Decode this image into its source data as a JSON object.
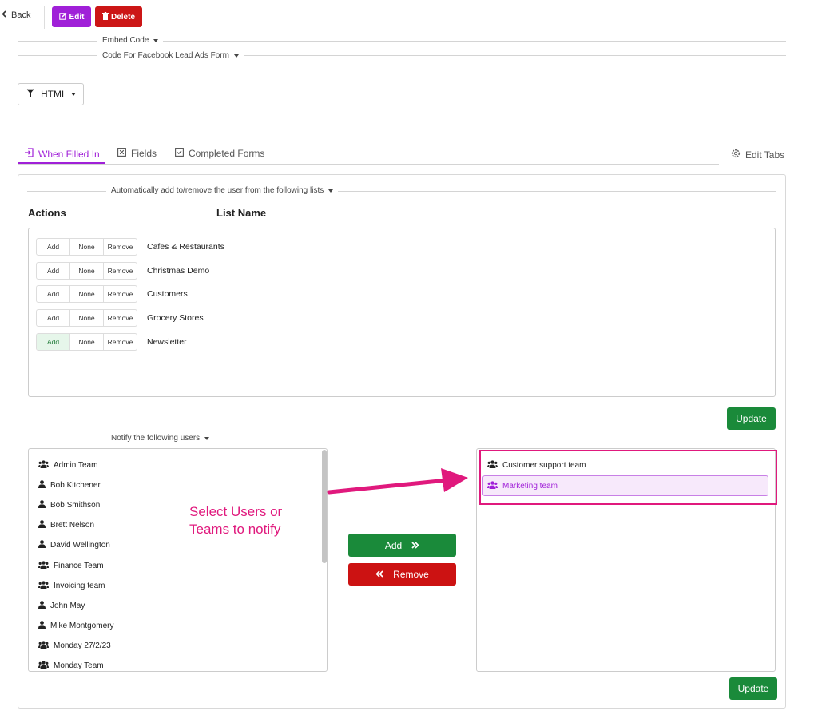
{
  "toolbar": {
    "back_label": "Back",
    "edit_label": "Edit",
    "delete_label": "Delete"
  },
  "sections": {
    "embed_code": "Embed Code",
    "facebook_code": "Code For Facebook Lead Ads Form"
  },
  "format_dropdown": {
    "value": "HTML"
  },
  "tabs": [
    {
      "label": "When Filled In",
      "active": true
    },
    {
      "label": "Fields",
      "active": false
    },
    {
      "label": "Completed Forms",
      "active": false
    }
  ],
  "edit_tabs_label": "Edit Tabs",
  "lists_section": {
    "title": "Automatically add to/remove the user from the following lists",
    "actions_header": "Actions",
    "list_name_header": "List Name",
    "action_options": [
      "Add",
      "None",
      "Remove"
    ],
    "rows": [
      {
        "name": "Cafes & Restaurants",
        "selected": "None"
      },
      {
        "name": "Christmas Demo",
        "selected": "None"
      },
      {
        "name": "Customers",
        "selected": "None"
      },
      {
        "name": "Grocery Stores",
        "selected": "None"
      },
      {
        "name": "Newsletter",
        "selected": "Add"
      }
    ],
    "update_label": "Update"
  },
  "notify_section": {
    "title": "Notify the following users",
    "available": [
      {
        "name": "Admin Team",
        "type": "team"
      },
      {
        "name": "Bob Kitchener",
        "type": "user"
      },
      {
        "name": "Bob Smithson",
        "type": "user"
      },
      {
        "name": "Brett Nelson",
        "type": "user"
      },
      {
        "name": "David Wellington",
        "type": "user"
      },
      {
        "name": "Finance Team",
        "type": "team"
      },
      {
        "name": "Invoicing team",
        "type": "team"
      },
      {
        "name": "John May",
        "type": "user"
      },
      {
        "name": "Mike Montgomery",
        "type": "user"
      },
      {
        "name": "Monday 27/2/23",
        "type": "team"
      },
      {
        "name": "Monday Team",
        "type": "team"
      }
    ],
    "selected": [
      {
        "name": "Customer support team",
        "type": "team",
        "highlighted": false
      },
      {
        "name": "Marketing team",
        "type": "team",
        "highlighted": true
      }
    ],
    "add_label": "Add",
    "remove_label": "Remove",
    "update_label": "Update"
  },
  "annotation": {
    "line1": "Select Users or",
    "line2": "Teams to notify"
  },
  "colors": {
    "accent": "#a020d8",
    "danger": "#cc1212",
    "success": "#1a8a3a",
    "annotation": "#e0197d"
  }
}
